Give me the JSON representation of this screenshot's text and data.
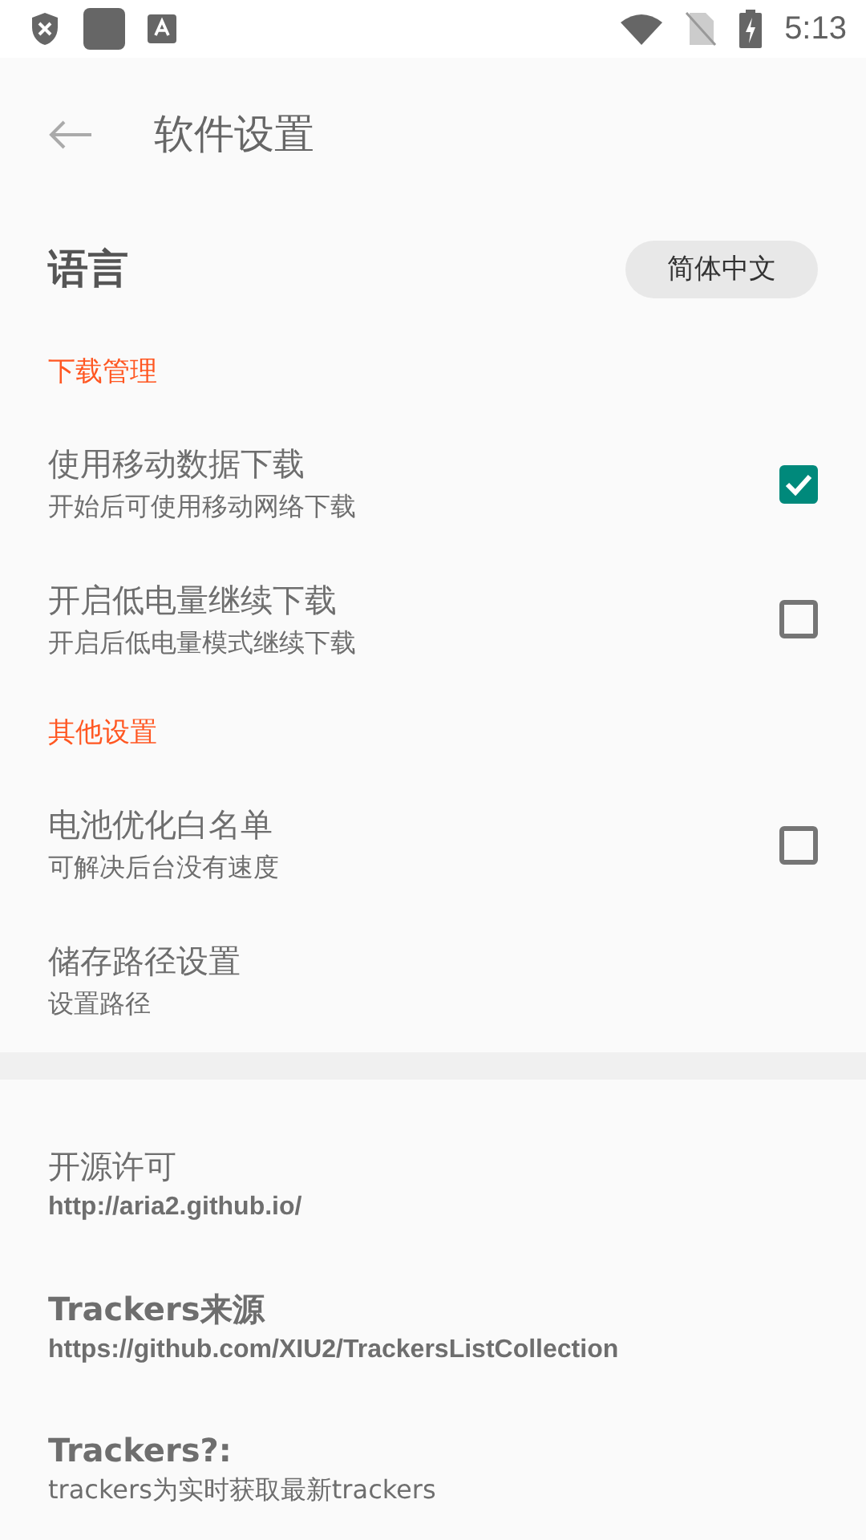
{
  "status_bar": {
    "time": "5:13"
  },
  "header": {
    "title": "软件设置"
  },
  "language": {
    "label": "语言",
    "value": "简体中文"
  },
  "sections": [
    {
      "title": "下载管理",
      "items": [
        {
          "kind": "checkbox",
          "title": "使用移动数据下载",
          "subtitle": "开始后可使用移动网络下载",
          "checked": true
        },
        {
          "kind": "checkbox",
          "title": "开启低电量继续下载",
          "subtitle": "开启后低电量模式继续下载",
          "checked": false
        }
      ]
    },
    {
      "title": "其他设置",
      "items": [
        {
          "kind": "checkbox",
          "title": "电池优化白名单",
          "subtitle": "可解决后台没有速度",
          "checked": false
        },
        {
          "kind": "plain",
          "title": "储存路径设置",
          "subtitle": "设置路径"
        }
      ]
    }
  ],
  "about": [
    {
      "title": "开源许可",
      "subtitle": "http://aria2.github.io/"
    },
    {
      "title": "Trackers来源",
      "subtitle": "https://github.com/XIU2/TrackersListCollection"
    },
    {
      "title": "Trackers?:",
      "subtitle": "trackers为实时获取最新trackers"
    }
  ]
}
